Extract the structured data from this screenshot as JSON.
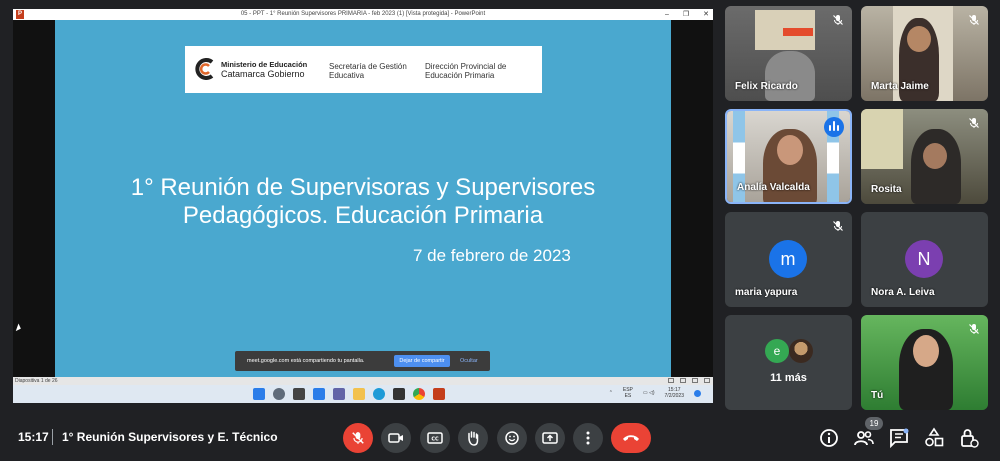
{
  "window": {
    "title": "05 - PPT - 1° Reunión Supervisores PRIMARIA - feb 2023 (1) [Vista protegida] - PowerPoint",
    "app_icon": "P",
    "min": "–",
    "max": "❐",
    "close": "✕"
  },
  "slide": {
    "ministry": "Ministerio de Educación",
    "catamarca": "Catamarca Gobierno",
    "secretaria": "Secretaría de Gestión Educativa",
    "direccion": "Dirección Provincial de Educación Primaria",
    "title_line1": "1° Reunión de Supervisoras y Supervisores",
    "title_line2": "Pedagógicos. Educación Primaria",
    "date": "7 de febrero de 2023"
  },
  "ppt_status": {
    "slide_counter": "Diapositiva 1 de 26"
  },
  "share_notice": {
    "text": "meet.google.com está compartiendo tu pantalla.",
    "stop_label": "Dejar de compartir",
    "hide_label": "Ocultar"
  },
  "windows_taskbar": {
    "lang_top": "ESP",
    "lang_bottom": "ES",
    "time": "15:17",
    "date": "7/2/2023"
  },
  "participants": [
    {
      "name": "Felix Ricardo",
      "muted": true,
      "video": true
    },
    {
      "name": "Marta Jaime",
      "muted": true,
      "video": true
    },
    {
      "name": "Analía Valcalda",
      "muted": false,
      "speaking": true,
      "video": true
    },
    {
      "name": "Rosita",
      "muted": true,
      "video": true
    },
    {
      "name": "maria yapura",
      "muted": true,
      "video": false,
      "initial": "m",
      "color": "#1a73e8"
    },
    {
      "name": "Nora A. Leiva",
      "muted": false,
      "video": false,
      "initial": "N",
      "color": "#7b3fb0"
    },
    {
      "name": "11 más",
      "initial": "e",
      "color": "#34a853"
    },
    {
      "name": "Tú",
      "muted": true,
      "video": true
    }
  ],
  "bottombar": {
    "time": "15:17",
    "meeting_name": "1° Reunión Supervisores y E. Técnico",
    "participant_count": "19"
  },
  "colors": {
    "meet_bg": "#202124",
    "tile_bg": "#3c4043",
    "danger": "#ea4335",
    "accent": "#8ab4f8",
    "slide_bg": "#4aa8cf"
  }
}
